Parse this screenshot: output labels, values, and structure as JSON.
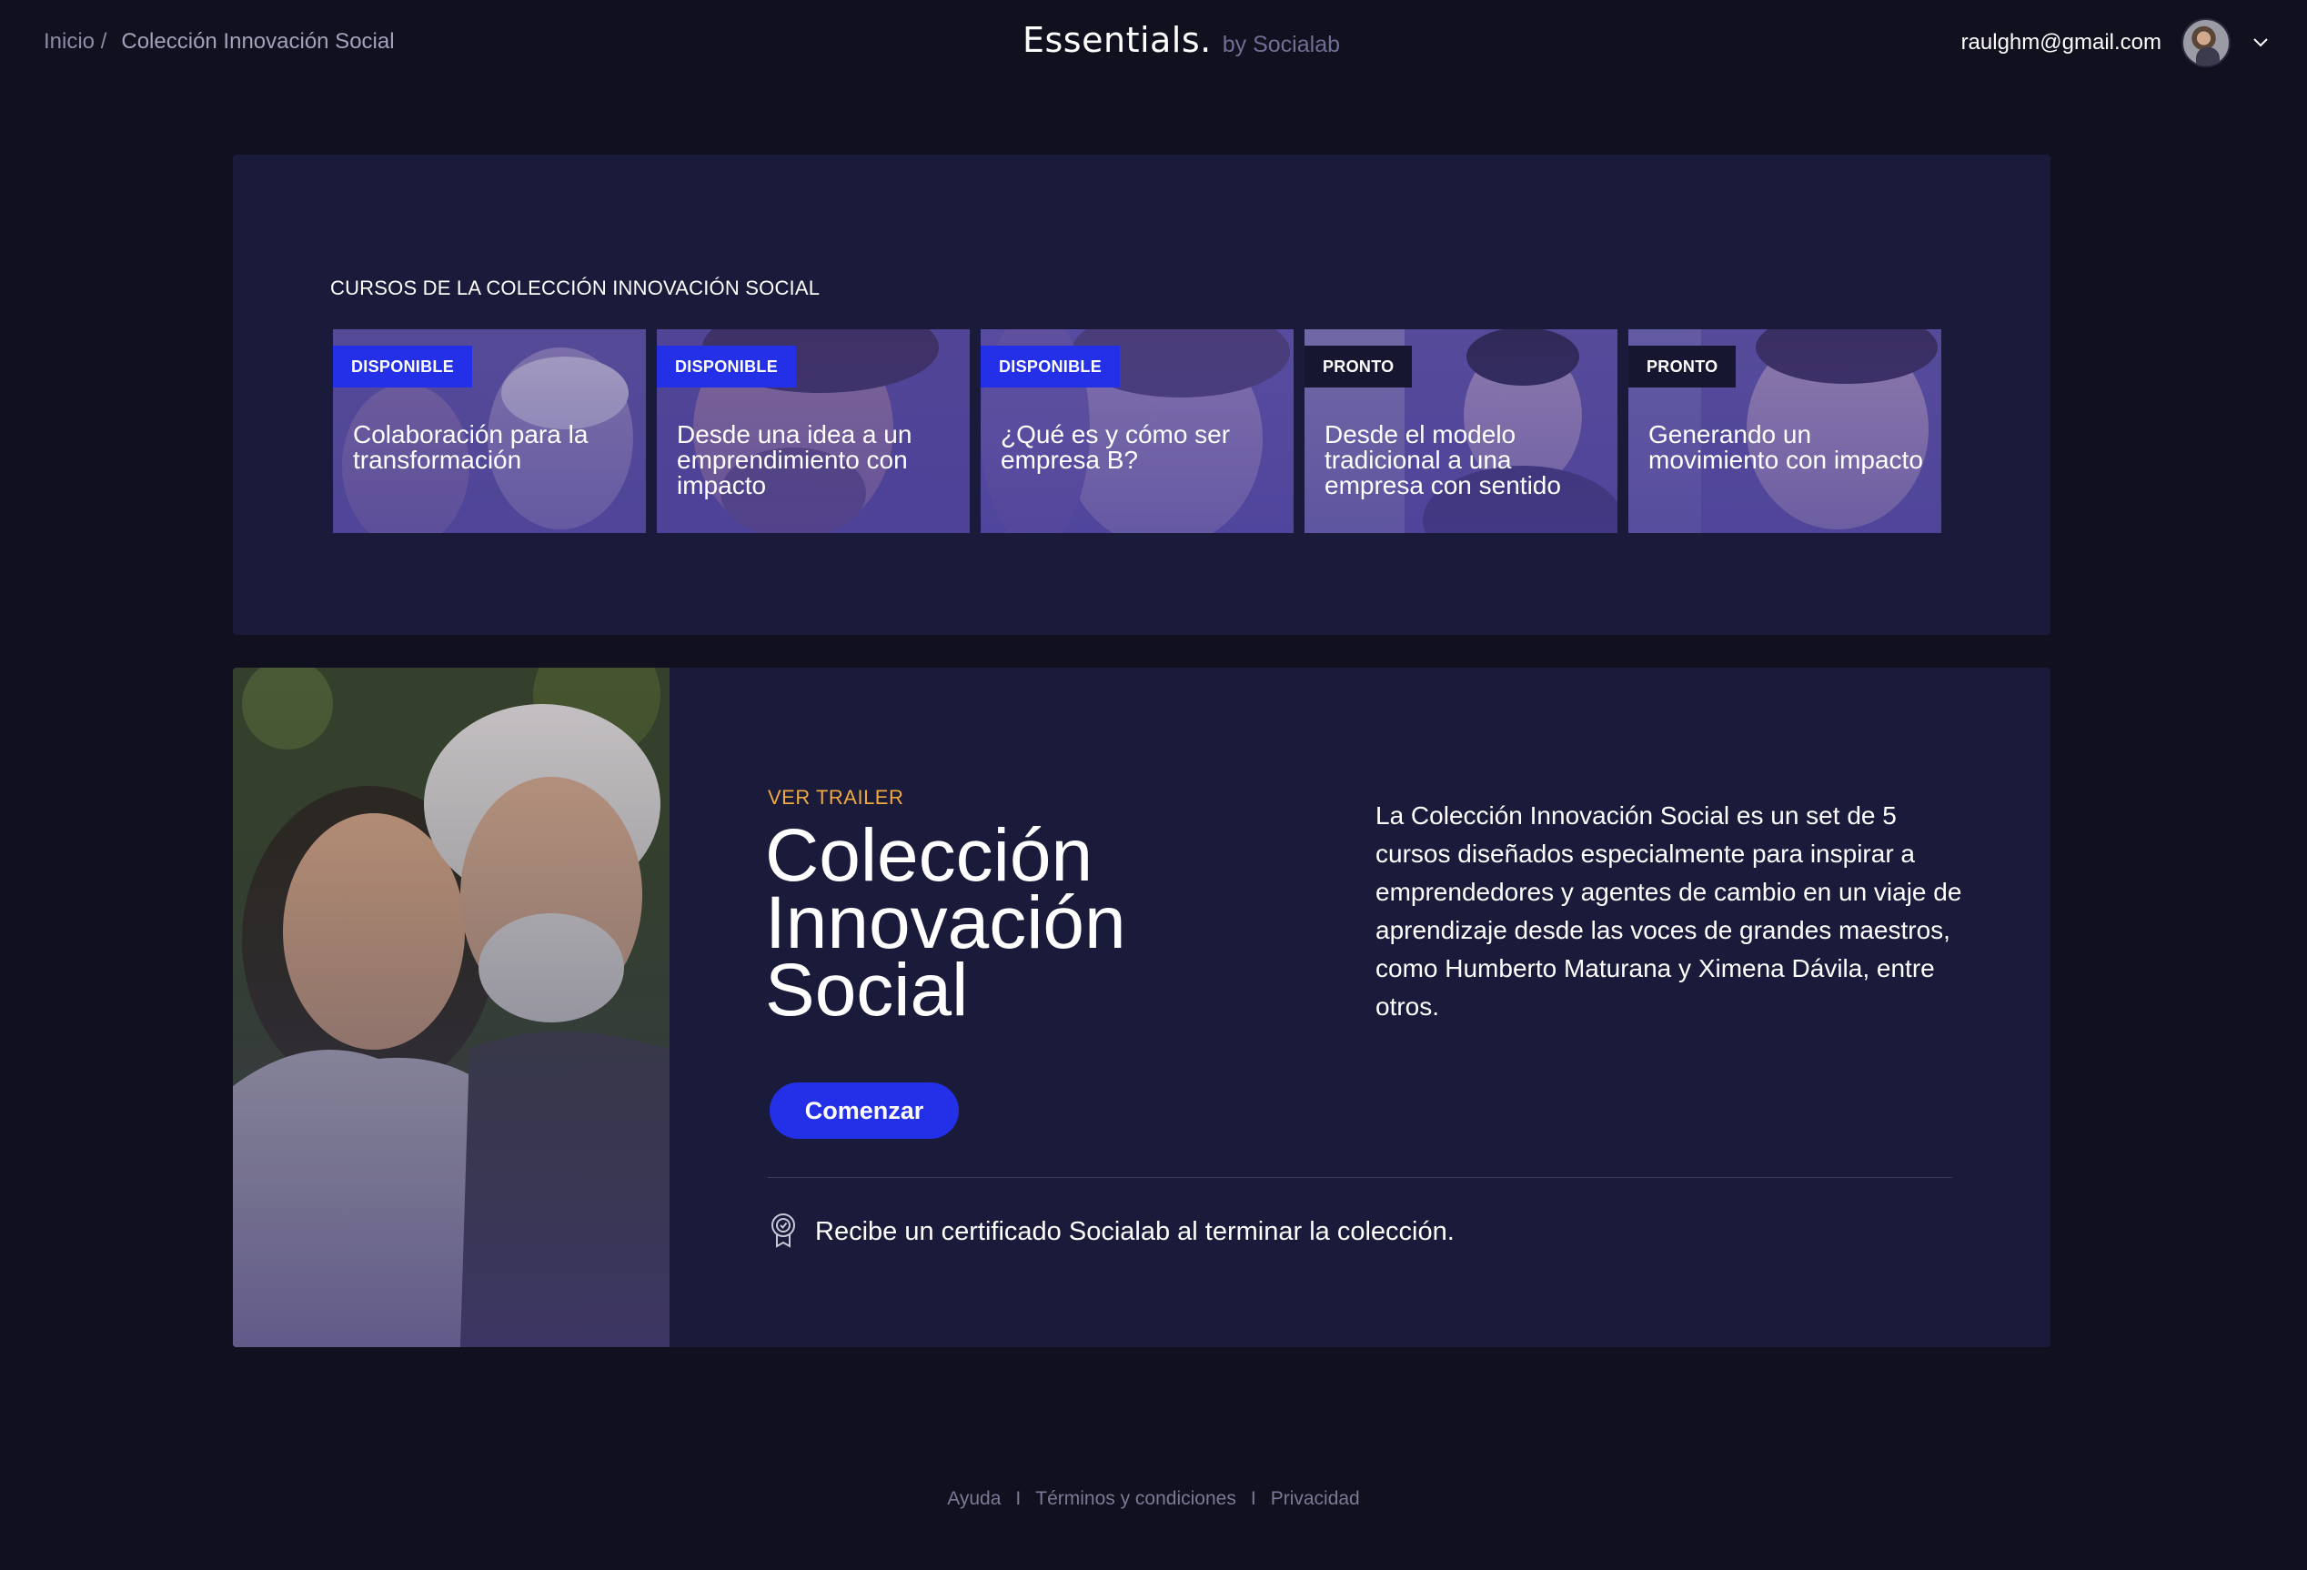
{
  "header": {
    "breadcrumb": {
      "home": "Inicio /",
      "current": "Colección Innovación Social"
    },
    "brand": {
      "logo": "Essentials.",
      "by": "by Socialab"
    },
    "user": {
      "email": "raulghm@gmail.com",
      "avatar_icon": "user-avatar",
      "menu_icon": "chevron-down-icon"
    }
  },
  "courses": {
    "heading": "CURSOS DE LA COLECCIÓN INNOVACIÓN SOCIAL",
    "items": [
      {
        "badge": "DISPONIBLE",
        "title": "Colaboración para la transformación"
      },
      {
        "badge": "DISPONIBLE",
        "title": "Desde una idea a un emprendimiento con impacto"
      },
      {
        "badge": "DISPONIBLE",
        "title": "¿Qué es y cómo ser empresa B?"
      },
      {
        "badge": "PRONTO",
        "title": "Desde el modelo tradicional a una empresa con sentido"
      },
      {
        "badge": "PRONTO",
        "title": "Generando un movimiento con impacto"
      }
    ]
  },
  "collection": {
    "trailer": "VER TRAILER",
    "title_line1": "Colección",
    "title_line2": "Innovación",
    "title_line3": "Social",
    "start_button": "Comenzar",
    "description": "La Colección Innovación Social es un set de 5 cursos diseñados especialmente para inspirar a emprendedores y agentes de cambio en un viaje de aprendizaje desde las voces de grandes maestros, como Humberto Maturana y Ximena Dávila, entre otros.",
    "certificate": "Recibe un certificado Socialab al terminar la colección.",
    "certificate_icon": "certificate-ribbon-icon"
  },
  "footer": {
    "links": [
      "Ayuda",
      "Términos y condiciones",
      "Privacidad"
    ],
    "separator": "I"
  },
  "colors": {
    "background": "#10101f",
    "panel": "#1a1a3a",
    "accent_blue": "#2330e8",
    "trailer_orange": "#f0a93c",
    "badge_dark": "#161630"
  }
}
